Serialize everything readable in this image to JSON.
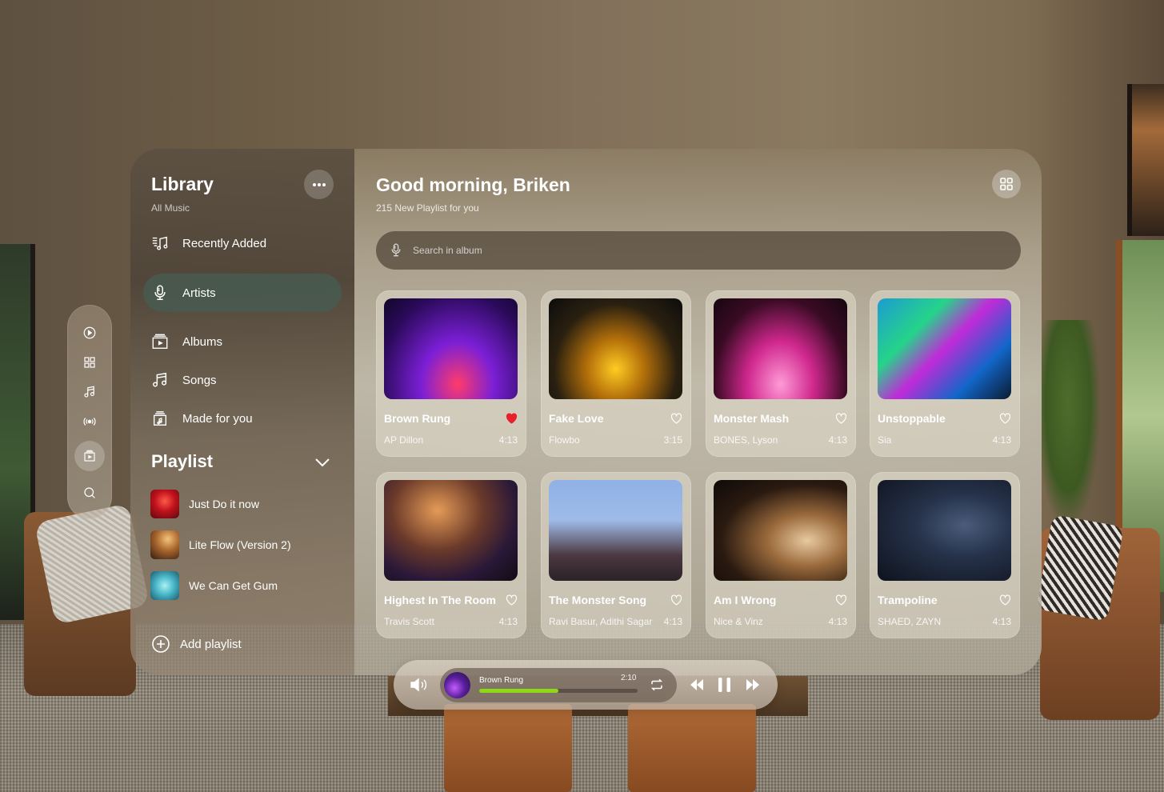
{
  "sidebar": {
    "title": "Library",
    "subtitle": "All Music",
    "items": [
      {
        "label": "Recently Added",
        "icon": "recently-added-icon",
        "active": false
      },
      {
        "label": "Artists",
        "icon": "microphone-icon",
        "active": true
      },
      {
        "label": "Albums",
        "icon": "album-icon",
        "active": false
      },
      {
        "label": "Songs",
        "icon": "music-note-icon",
        "active": false
      },
      {
        "label": "Made for you",
        "icon": "made-for-you-icon",
        "active": false
      }
    ],
    "playlist_title": "Playlist",
    "playlists": [
      {
        "label": "Just Do it now"
      },
      {
        "label": "Lite Flow (Version 2)"
      },
      {
        "label": "We Can Get Gum"
      }
    ],
    "add_playlist": "Add playlist"
  },
  "rail": {
    "items": [
      "play-circle-icon",
      "grid-icon",
      "music-note-icon",
      "broadcast-icon",
      "album-icon",
      "search-icon"
    ],
    "active_index": 4
  },
  "main": {
    "greeting": "Good morning, Briken",
    "subtitle": "215 New Playlist for you",
    "search": {
      "placeholder": "Search in album",
      "value": ""
    },
    "cards": [
      {
        "title": "Brown Rung",
        "artist": "AP Dillon",
        "duration": "4:13",
        "liked": true
      },
      {
        "title": "Fake Love",
        "artist": "Flowbo",
        "duration": "3:15",
        "liked": false
      },
      {
        "title": "Monster Mash",
        "artist": "BONES, Lyson",
        "duration": "4:13",
        "liked": false
      },
      {
        "title": "Unstoppable",
        "artist": "Sia",
        "duration": "4:13",
        "liked": false
      },
      {
        "title": "Highest In The Room",
        "artist": "Travis Scott",
        "duration": "4:13",
        "liked": false
      },
      {
        "title": "The Monster Song",
        "artist": "Ravi Basur, Adithi Sagar",
        "duration": "4:13",
        "liked": false
      },
      {
        "title": "Am I Wrong",
        "artist": "Nice & Vinz",
        "duration": "4:13",
        "liked": false
      },
      {
        "title": "Trampoline",
        "artist": "SHAED, ZAYN",
        "duration": "4:13",
        "liked": false
      }
    ]
  },
  "player": {
    "track": "Brown Rung",
    "elapsed": "2:10",
    "progress": 0.5,
    "state": "playing"
  },
  "colors": {
    "liked_heart": "#e8202a",
    "progress_fill": "#8fd912",
    "active_nav": "#485a50"
  }
}
